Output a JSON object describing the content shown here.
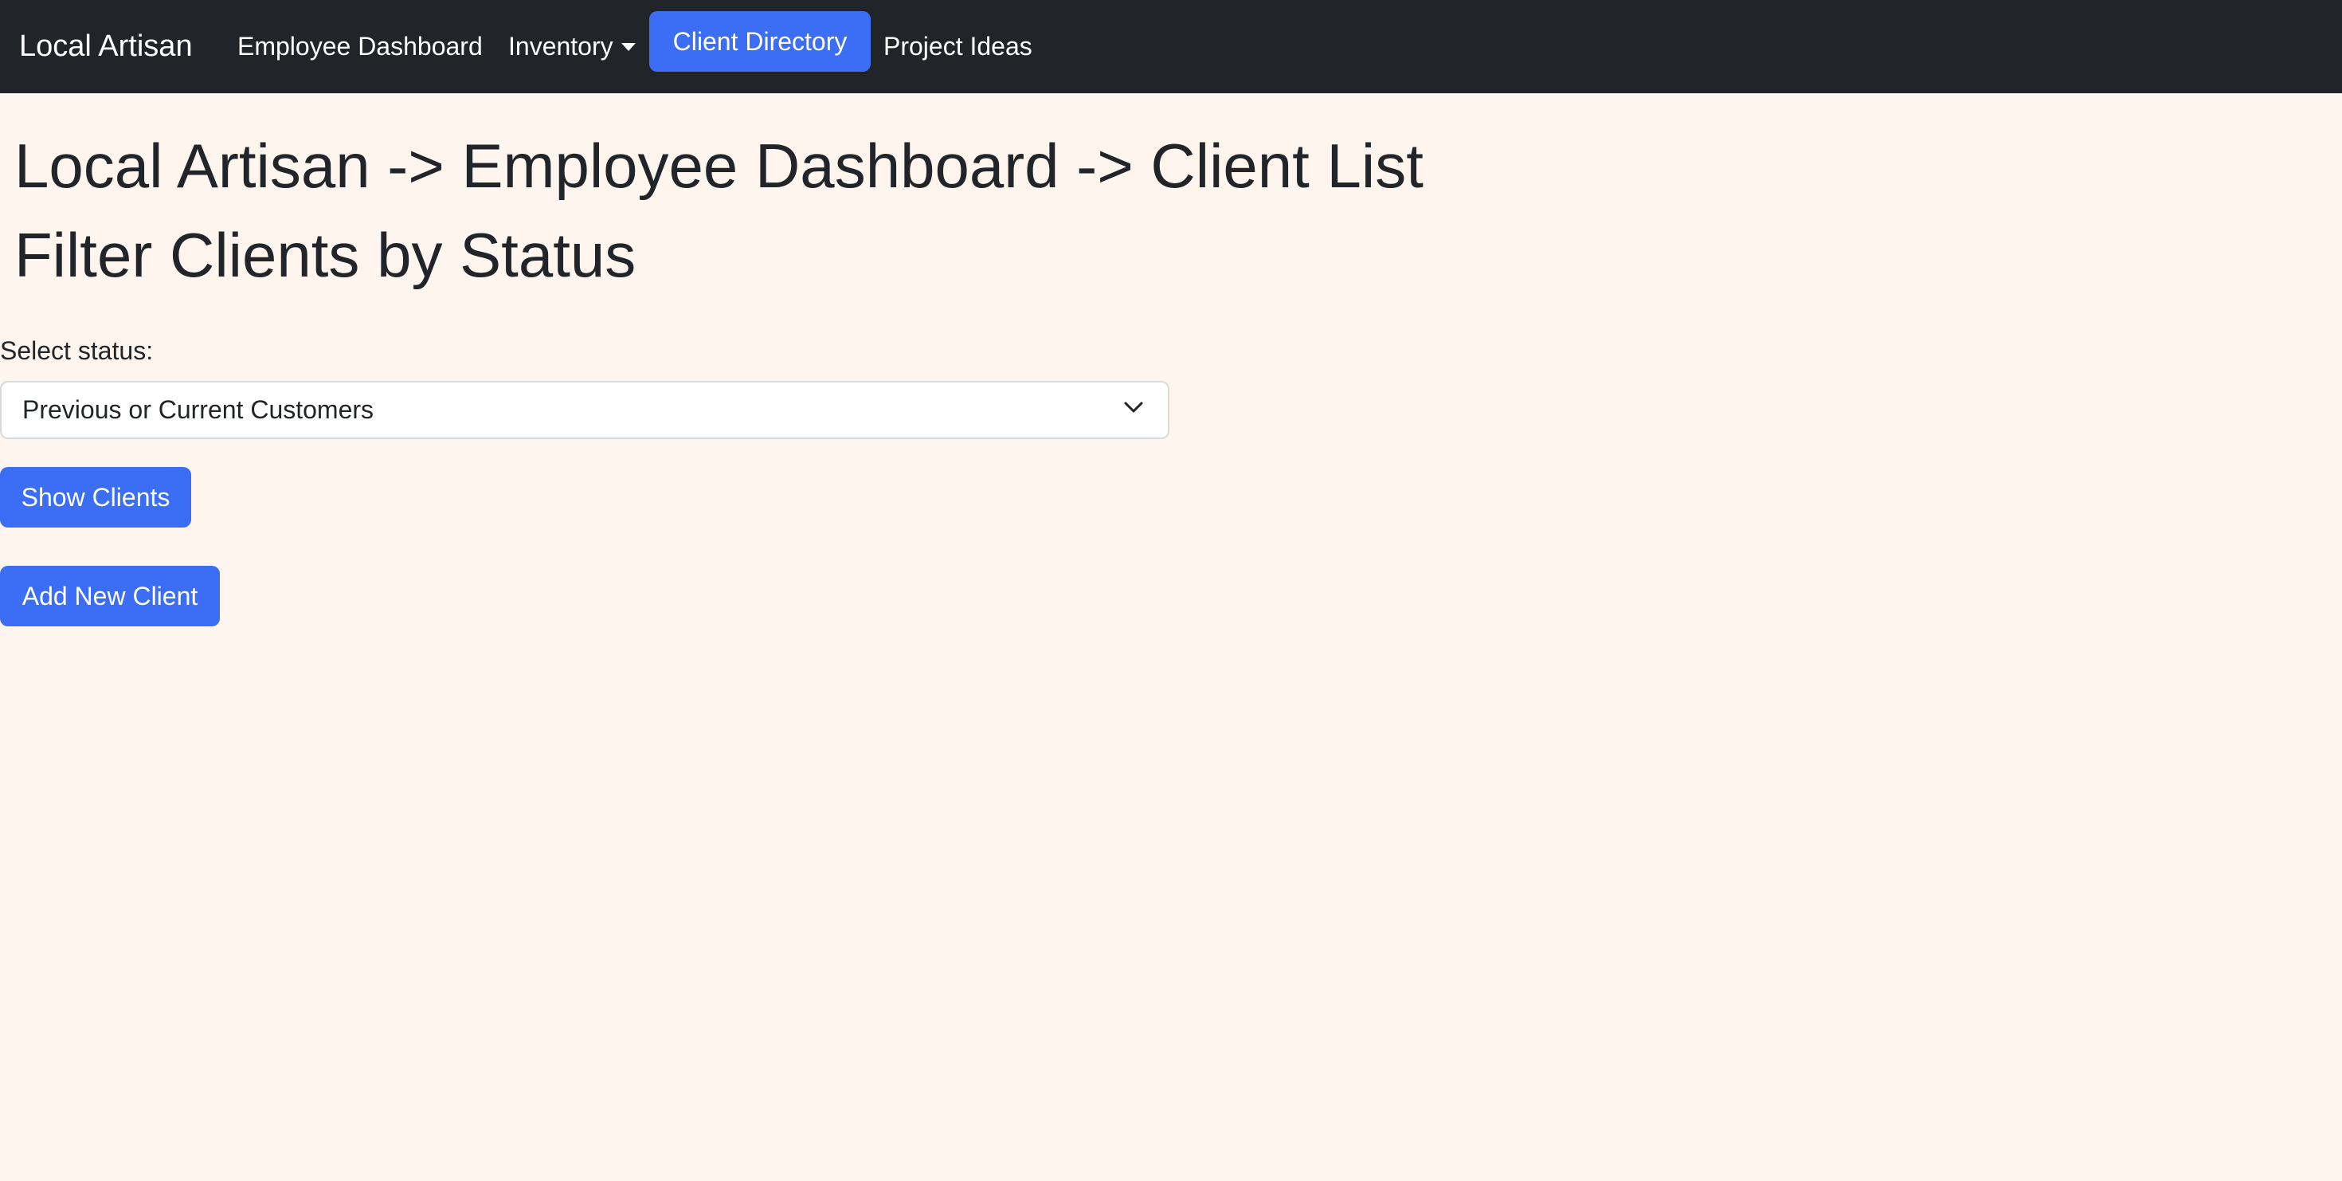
{
  "navbar": {
    "brand": "Local Artisan",
    "items": [
      {
        "label": "Employee Dashboard"
      },
      {
        "label": "Inventory",
        "icon": "caret-down-icon"
      },
      {
        "label": "Client Directory",
        "active": true
      },
      {
        "label": "Project Ideas"
      }
    ]
  },
  "main": {
    "breadcrumb_title": "Local Artisan -> Employee Dashboard -> Client List",
    "section_title": "Filter Clients by Status",
    "filter": {
      "label": "Select status:",
      "selected": "Previous or Current Customers",
      "icon": "chevron-down-icon"
    },
    "show_button": "Show Clients",
    "add_button": "Add New Client"
  },
  "colors": {
    "navbar_bg": "#212529",
    "page_bg": "#fdf5ee",
    "accent": "#3b6ef5",
    "text": "#212529"
  }
}
